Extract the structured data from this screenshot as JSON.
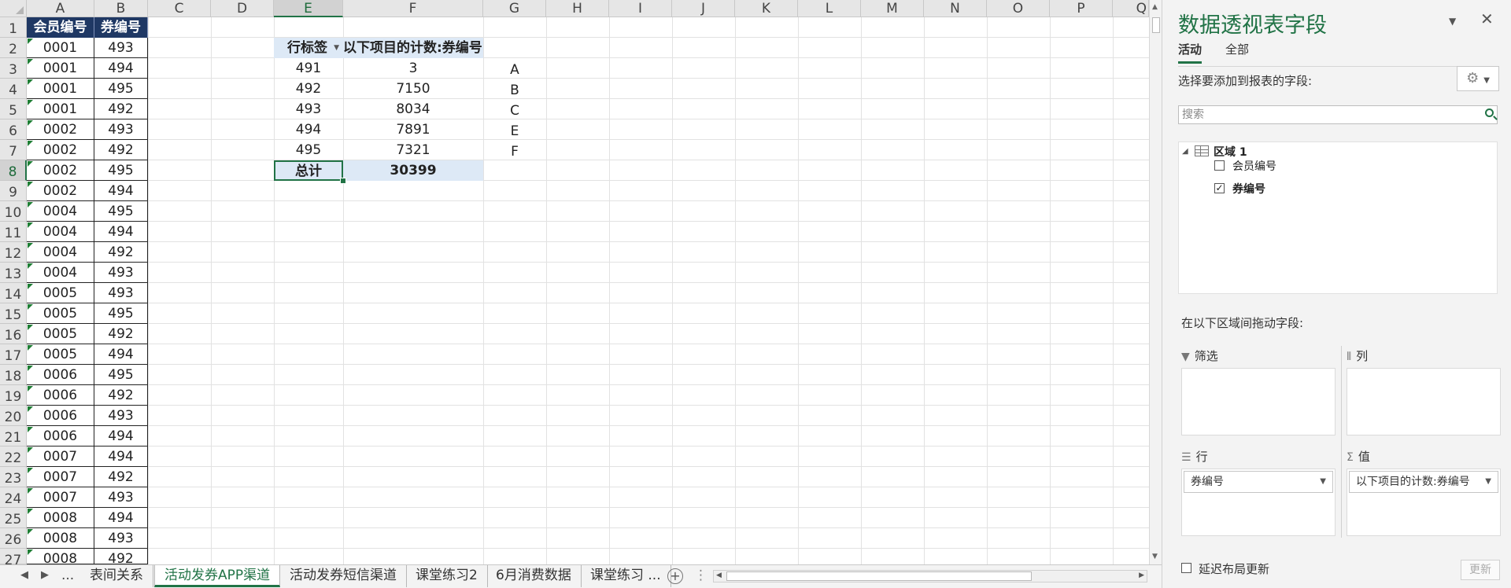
{
  "columns": [
    "A",
    "B",
    "C",
    "D",
    "E",
    "F",
    "G",
    "H",
    "I",
    "J",
    "K",
    "L",
    "M",
    "N",
    "O",
    "P",
    "Q"
  ],
  "rows": [
    "1",
    "2",
    "3",
    "4",
    "5",
    "6",
    "7",
    "8",
    "9",
    "10",
    "11",
    "12",
    "13",
    "14",
    "15",
    "16",
    "17",
    "18",
    "19",
    "20",
    "21",
    "22",
    "23",
    "24",
    "25",
    "26",
    "27"
  ],
  "table": {
    "headers": [
      "会员编号",
      "券编号"
    ],
    "member_ids": [
      "0001",
      "0001",
      "0001",
      "0001",
      "0002",
      "0002",
      "0002",
      "0002",
      "0004",
      "0004",
      "0004",
      "0004",
      "0005",
      "0005",
      "0005",
      "0005",
      "0006",
      "0006",
      "0006",
      "0006",
      "0007",
      "0007",
      "0007",
      "0008",
      "0008",
      "0008"
    ],
    "coupon_ids": [
      "493",
      "494",
      "495",
      "492",
      "493",
      "492",
      "495",
      "494",
      "495",
      "494",
      "492",
      "493",
      "493",
      "495",
      "492",
      "494",
      "495",
      "492",
      "493",
      "494",
      "494",
      "492",
      "493",
      "494",
      "493",
      "492"
    ]
  },
  "pivot": {
    "row_header": "行标签",
    "value_header": "以下项目的计数:券编号",
    "labels": [
      "491",
      "492",
      "493",
      "494",
      "495"
    ],
    "values": [
      "3",
      "7150",
      "8034",
      "7891",
      "7321"
    ],
    "total_label": "总计",
    "total_value": "30399"
  },
  "side_letters": [
    "A",
    "B",
    "C",
    "E",
    "F"
  ],
  "sheet_tabs": {
    "ellipsis": "...",
    "tabs": [
      "表间关系",
      "活动发券APP渠道",
      "活动发券短信渠道",
      "课堂练习2",
      "6月消费数据",
      "课堂练习 ..."
    ],
    "active_index": 1
  },
  "pane": {
    "title": "数据透视表字段",
    "tab_active": "活动",
    "tab_all": "全部",
    "choose_label": "选择要添加到报表的字段:",
    "search_placeholder": "搜索",
    "table_name": "区域 1",
    "fields": [
      {
        "label": "会员编号",
        "checked": false
      },
      {
        "label": "券编号",
        "checked": true
      }
    ],
    "drag_label": "在以下区域间拖动字段:",
    "zone_filter": "筛选",
    "zone_columns": "列",
    "zone_rows": "行",
    "zone_values": "值",
    "rows_item": "券编号",
    "values_item": "以下项目的计数:券编号",
    "defer_label": "延迟布局更新",
    "update_button": "更新"
  },
  "colors": {
    "accent": "#217346",
    "header_fill": "#1f3864",
    "pivot_fill": "#dde9f6"
  }
}
